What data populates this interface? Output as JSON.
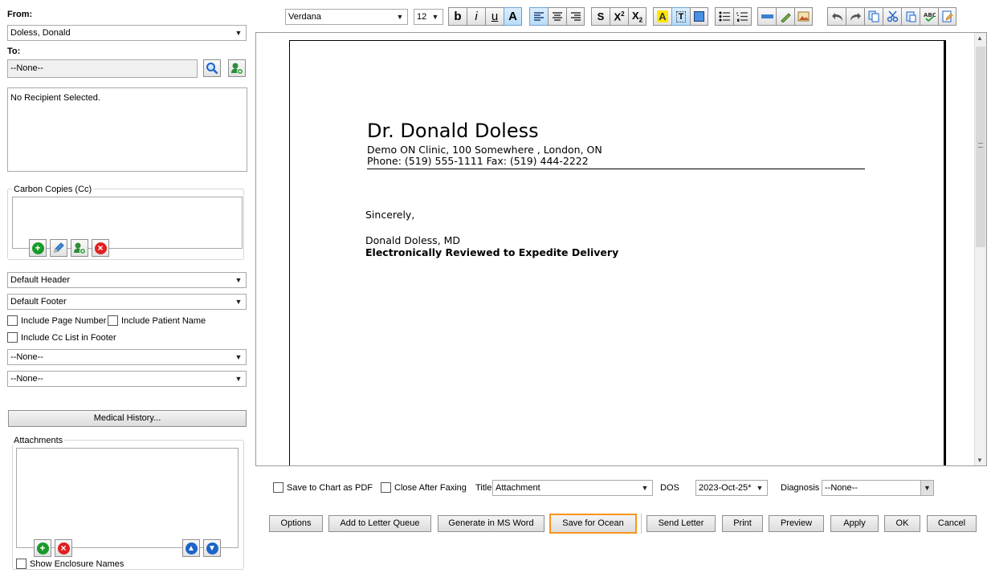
{
  "from": {
    "label": "From:",
    "value": "Doless, Donald"
  },
  "to": {
    "label": "To:",
    "value": "--None--",
    "recipient_text": "No Recipient Selected."
  },
  "cc": {
    "legend": "Carbon Copies (Cc)"
  },
  "header_select": "Default Header",
  "footer_select": "Default Footer",
  "options_checks": {
    "page_number": "Include Page Number",
    "patient_name": "Include Patient Name",
    "cc_list": "Include Cc List in Footer"
  },
  "select_none_1": "--None--",
  "select_none_2": "--None--",
  "medical_history_button": "Medical History...",
  "attachments": {
    "legend": "Attachments",
    "show_names": "Show Enclosure Names"
  },
  "toolbar": {
    "font": "Verdana",
    "size": "12",
    "bold": "b",
    "italic": "i",
    "underline": "u",
    "font_color": "A",
    "strike": "S"
  },
  "letter": {
    "doctor_name": "Dr. Donald Doless",
    "clinic_line": "Demo ON Clinic, 100 Somewhere , London, ON",
    "contact_line": "Phone: (519) 555-1111 Fax: (519) 444-2222",
    "closing": "Sincerely,",
    "signature_name": "Donald Doless, MD",
    "signature_note": "Electronically Reviewed to Expedite Delivery"
  },
  "bottom": {
    "save_pdf": "Save to Chart as PDF",
    "close_after_faxing": "Close After Faxing",
    "title_label": "Title",
    "title_value": "Attachment",
    "dos_label": "DOS",
    "dos_value": "2023-Oct-25*",
    "diagnosis_label": "Diagnosis",
    "diagnosis_value": "--None--"
  },
  "actions": {
    "options": "Options",
    "letter_queue": "Add to Letter Queue",
    "ms_word": "Generate in MS Word",
    "ocean": "Save for Ocean",
    "send": "Send Letter",
    "print": "Print",
    "preview": "Preview",
    "apply": "Apply",
    "ok": "OK",
    "cancel": "Cancel"
  },
  "colors": {
    "highlight_outline": "#f7941d",
    "add_green": "#1a9a2a",
    "remove_red": "#e02020",
    "move_blue": "#1e64c8"
  }
}
